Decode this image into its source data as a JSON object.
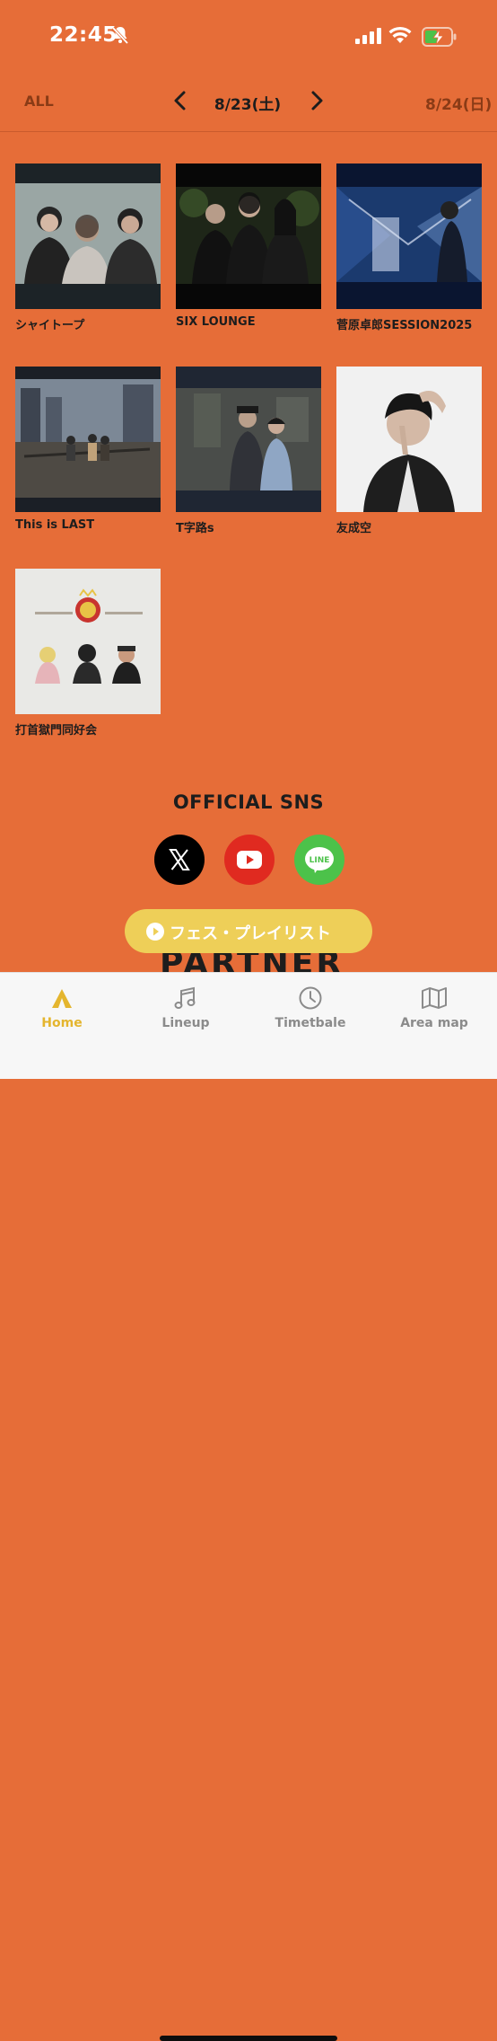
{
  "status_bar": {
    "time": "22:45",
    "icons": [
      "bell-muted-icon",
      "cellular-signal-icon",
      "wifi-icon",
      "battery-charging-icon"
    ]
  },
  "date_nav": {
    "all_label": "ALL",
    "current_date": "8/23(土)",
    "next_date": "8/24(日)"
  },
  "artists": [
    {
      "name": "シャイトープ"
    },
    {
      "name": "SIX LOUNGE"
    },
    {
      "name": "菅原卓郎SESSION2025"
    },
    {
      "name": "This is LAST"
    },
    {
      "name": "T字路s"
    },
    {
      "name": "友成空"
    },
    {
      "name": "打首獄門同好会"
    }
  ],
  "sns": {
    "title": "OFFICIAL SNS",
    "links": [
      "x-icon",
      "youtube-icon",
      "line-icon"
    ],
    "line_text": "LINE"
  },
  "partner": {
    "label": "PARTNER"
  },
  "playlist_button": {
    "label": "フェス・プレイリスト"
  },
  "tabs": [
    {
      "label": "Home",
      "icon": "home-icon",
      "active": true
    },
    {
      "label": "Lineup",
      "icon": "music-note-icon",
      "active": false
    },
    {
      "label": "Timetbale",
      "icon": "clock-icon",
      "active": false
    },
    {
      "label": "Area map",
      "icon": "map-icon",
      "active": false
    }
  ],
  "colors": {
    "background": "#E66D38",
    "accent": "#EECF58",
    "active_tab": "#E4B52E"
  }
}
